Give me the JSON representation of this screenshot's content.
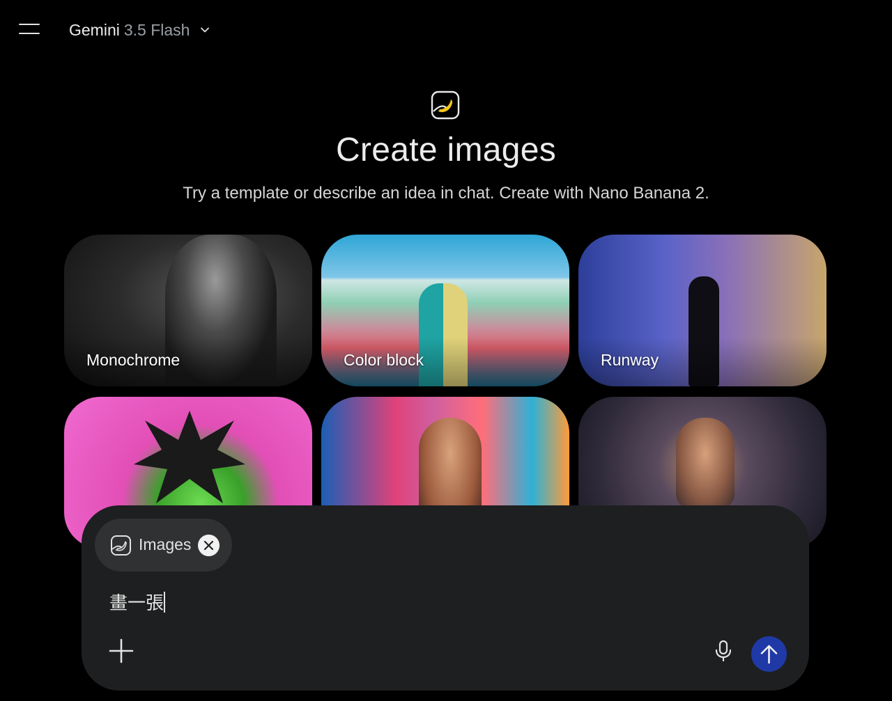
{
  "header": {
    "menu_icon": "hamburger-menu-icon",
    "model_name": "Gemini",
    "model_variant": "3.5 Flash",
    "dropdown_icon": "chevron-down-icon"
  },
  "hero": {
    "icon": "banana-image-icon",
    "title": "Create images",
    "subtitle": "Try a template or describe an idea in chat. Create with Nano Banana 2."
  },
  "templates": [
    {
      "label": "Monochrome"
    },
    {
      "label": "Color block"
    },
    {
      "label": "Runway"
    },
    {
      "label": ""
    },
    {
      "label": ""
    },
    {
      "label": ""
    }
  ],
  "composer": {
    "chip_label": "Images",
    "chip_icon": "image-tool-icon",
    "chip_close_icon": "close-icon",
    "prompt_value": "畫一張",
    "add_icon": "plus-icon",
    "mic_icon": "microphone-icon",
    "send_icon": "arrow-up-icon"
  },
  "colors": {
    "background": "#000000",
    "composer": "#1e1f20",
    "chip": "#2f3133",
    "send_button": "#1f3aa6"
  }
}
